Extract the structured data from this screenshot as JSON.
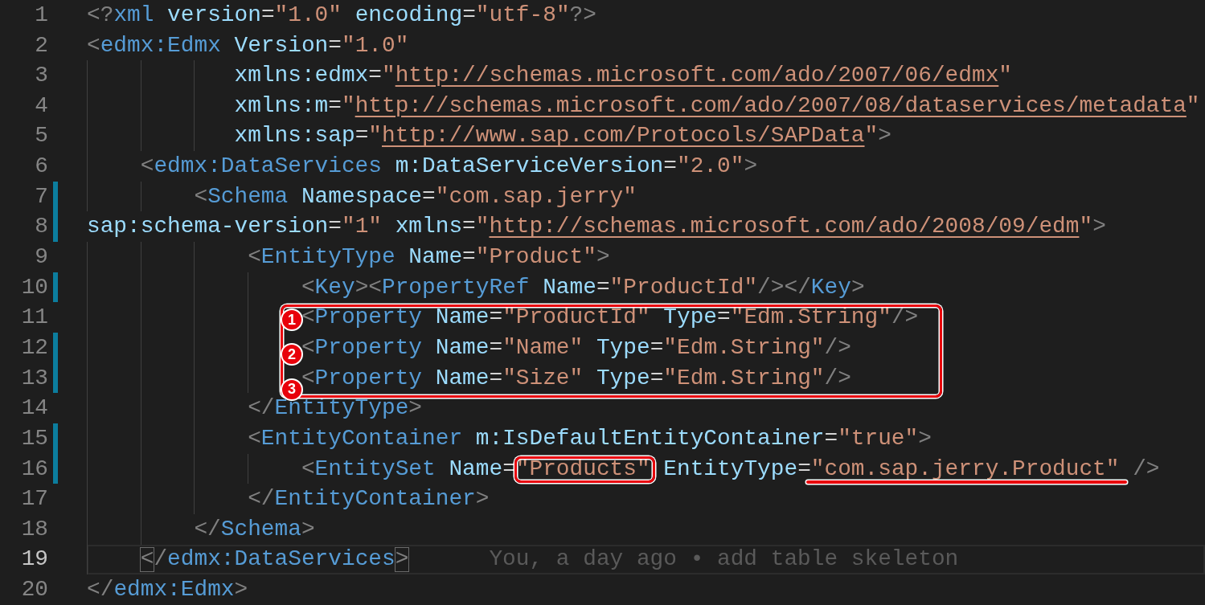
{
  "editor": {
    "lines": [
      {
        "number": "1",
        "changed": false,
        "boxed": false,
        "current": false,
        "tokens": [
          {
            "kind": "punct",
            "text": "<?"
          },
          {
            "kind": "tag",
            "text": "xml "
          },
          {
            "kind": "attr",
            "text": "version"
          },
          {
            "kind": "eq",
            "text": "="
          },
          {
            "kind": "str",
            "text": "\"1.0\" "
          },
          {
            "kind": "attr",
            "text": "encoding"
          },
          {
            "kind": "eq",
            "text": "="
          },
          {
            "kind": "str",
            "text": "\"utf-8\""
          },
          {
            "kind": "punct",
            "text": "?>"
          }
        ]
      },
      {
        "number": "2",
        "changed": false,
        "boxed": false,
        "current": false,
        "tokens": [
          {
            "kind": "punct",
            "text": "<"
          },
          {
            "kind": "tag",
            "text": "edmx:Edmx "
          },
          {
            "kind": "attr",
            "text": "Version"
          },
          {
            "kind": "eq",
            "text": "="
          },
          {
            "kind": "str",
            "text": "\"1.0\""
          }
        ]
      },
      {
        "number": "3",
        "changed": false,
        "boxed": false,
        "current": false,
        "tokens": [
          {
            "kind": "attr",
            "text": "           xmlns:edmx"
          },
          {
            "kind": "eq",
            "text": "="
          },
          {
            "kind": "str",
            "text": "\""
          },
          {
            "kind": "url",
            "text": "http://schemas.microsoft.com/ado/2007/06/edmx"
          },
          {
            "kind": "str",
            "text": "\""
          }
        ]
      },
      {
        "number": "4",
        "changed": false,
        "boxed": false,
        "current": false,
        "tokens": [
          {
            "kind": "attr",
            "text": "           xmlns:m"
          },
          {
            "kind": "eq",
            "text": "="
          },
          {
            "kind": "str",
            "text": "\""
          },
          {
            "kind": "url",
            "text": "http://schemas.microsoft.com/ado/2007/08/dataservices/metadata"
          },
          {
            "kind": "str",
            "text": "\""
          }
        ]
      },
      {
        "number": "5",
        "changed": false,
        "boxed": false,
        "current": false,
        "tokens": [
          {
            "kind": "attr",
            "text": "           xmlns:sap"
          },
          {
            "kind": "eq",
            "text": "="
          },
          {
            "kind": "str",
            "text": "\""
          },
          {
            "kind": "url",
            "text": "http://www.sap.com/Protocols/SAPData"
          },
          {
            "kind": "str",
            "text": "\""
          },
          {
            "kind": "punct",
            "text": ">"
          }
        ]
      },
      {
        "number": "6",
        "changed": false,
        "boxed": false,
        "current": false,
        "tokens": [
          {
            "kind": "punct",
            "text": "    <"
          },
          {
            "kind": "tag",
            "text": "edmx:DataServices "
          },
          {
            "kind": "attr",
            "text": "m:DataServiceVersion"
          },
          {
            "kind": "eq",
            "text": "="
          },
          {
            "kind": "str",
            "text": "\"2.0\""
          },
          {
            "kind": "punct",
            "text": ">"
          }
        ]
      },
      {
        "number": "7",
        "changed": true,
        "boxed": false,
        "current": false,
        "tokens": [
          {
            "kind": "punct",
            "text": "        <"
          },
          {
            "kind": "tag",
            "text": "Schema "
          },
          {
            "kind": "attr",
            "text": "Namespace"
          },
          {
            "kind": "eq",
            "text": "="
          },
          {
            "kind": "str",
            "text": "\"com.sap.jerry\""
          }
        ]
      },
      {
        "number": "8",
        "changed": true,
        "boxed": false,
        "current": false,
        "tokens": [
          {
            "kind": "attr",
            "text": "sap:schema-version"
          },
          {
            "kind": "eq",
            "text": "="
          },
          {
            "kind": "str",
            "text": "\"1\" "
          },
          {
            "kind": "attr",
            "text": "xmlns"
          },
          {
            "kind": "eq",
            "text": "="
          },
          {
            "kind": "str",
            "text": "\""
          },
          {
            "kind": "url",
            "text": "http://schemas.microsoft.com/ado/2008/09/edm"
          },
          {
            "kind": "str",
            "text": "\""
          },
          {
            "kind": "punct",
            "text": ">"
          }
        ]
      },
      {
        "number": "9",
        "changed": false,
        "boxed": false,
        "current": false,
        "tokens": [
          {
            "kind": "punct",
            "text": "            <"
          },
          {
            "kind": "tag",
            "text": "EntityType "
          },
          {
            "kind": "attr",
            "text": "Name"
          },
          {
            "kind": "eq",
            "text": "="
          },
          {
            "kind": "str",
            "text": "\"Product\""
          },
          {
            "kind": "punct",
            "text": ">"
          }
        ]
      },
      {
        "number": "10",
        "changed": true,
        "boxed": false,
        "current": false,
        "tokens": [
          {
            "kind": "punct",
            "text": "                <"
          },
          {
            "kind": "tag",
            "text": "Key"
          },
          {
            "kind": "punct",
            "text": "><"
          },
          {
            "kind": "tag",
            "text": "PropertyRef "
          },
          {
            "kind": "attr",
            "text": "Name"
          },
          {
            "kind": "eq",
            "text": "="
          },
          {
            "kind": "str",
            "text": "\"ProductId\""
          },
          {
            "kind": "punct",
            "text": "/></"
          },
          {
            "kind": "tag",
            "text": "Key"
          },
          {
            "kind": "punct",
            "text": ">"
          }
        ]
      },
      {
        "number": "11",
        "changed": false,
        "boxed": true,
        "current": false,
        "badge": "1",
        "tokens": [
          {
            "kind": "punct",
            "text": "                <"
          },
          {
            "kind": "tag",
            "text": "Property "
          },
          {
            "kind": "attr",
            "text": "Name"
          },
          {
            "kind": "eq",
            "text": "="
          },
          {
            "kind": "str",
            "text": "\"ProductId\" "
          },
          {
            "kind": "attr",
            "text": "Type"
          },
          {
            "kind": "eq",
            "text": "="
          },
          {
            "kind": "str",
            "text": "\"Edm.String\""
          },
          {
            "kind": "punct",
            "text": "/>"
          }
        ]
      },
      {
        "number": "12",
        "changed": true,
        "boxed": true,
        "current": false,
        "badge": "2",
        "tokens": [
          {
            "kind": "punct",
            "text": "                <"
          },
          {
            "kind": "tag",
            "text": "Property "
          },
          {
            "kind": "attr",
            "text": "Name"
          },
          {
            "kind": "eq",
            "text": "="
          },
          {
            "kind": "str",
            "text": "\"Name\" "
          },
          {
            "kind": "attr",
            "text": "Type"
          },
          {
            "kind": "eq",
            "text": "="
          },
          {
            "kind": "str",
            "text": "\"Edm.String\""
          },
          {
            "kind": "punct",
            "text": "/>"
          }
        ]
      },
      {
        "number": "13",
        "changed": true,
        "boxed": true,
        "current": false,
        "badge": "3",
        "tokens": [
          {
            "kind": "punct",
            "text": "                <"
          },
          {
            "kind": "tag",
            "text": "Property "
          },
          {
            "kind": "attr",
            "text": "Name"
          },
          {
            "kind": "eq",
            "text": "="
          },
          {
            "kind": "str",
            "text": "\"Size\" "
          },
          {
            "kind": "attr",
            "text": "Type"
          },
          {
            "kind": "eq",
            "text": "="
          },
          {
            "kind": "str",
            "text": "\"Edm.String\""
          },
          {
            "kind": "punct",
            "text": "/>"
          }
        ]
      },
      {
        "number": "14",
        "changed": false,
        "boxed": false,
        "current": false,
        "tokens": [
          {
            "kind": "punct",
            "text": "            </"
          },
          {
            "kind": "tag",
            "text": "EntityType"
          },
          {
            "kind": "punct",
            "text": ">"
          }
        ]
      },
      {
        "number": "15",
        "changed": true,
        "boxed": false,
        "current": false,
        "tokens": [
          {
            "kind": "punct",
            "text": "            <"
          },
          {
            "kind": "tag",
            "text": "EntityContainer "
          },
          {
            "kind": "attr",
            "text": "m:IsDefaultEntityContainer"
          },
          {
            "kind": "eq",
            "text": "="
          },
          {
            "kind": "str",
            "text": "\"true\""
          },
          {
            "kind": "punct",
            "text": ">"
          }
        ]
      },
      {
        "number": "16",
        "changed": true,
        "boxed": false,
        "current": false,
        "tokens": [
          {
            "kind": "punct",
            "text": "                <"
          },
          {
            "kind": "tag",
            "text": "EntitySet "
          },
          {
            "kind": "attr",
            "text": "Name"
          },
          {
            "kind": "eq",
            "text": "="
          },
          {
            "kind": "str",
            "text": "\"Products\"",
            "circled": true
          },
          {
            "kind": "attr",
            "text": " EntityType"
          },
          {
            "kind": "eq",
            "text": "="
          },
          {
            "kind": "str",
            "text": "\"com.sap.jerry.Product\"",
            "underlined": true
          },
          {
            "kind": "punct",
            "text": " />"
          }
        ]
      },
      {
        "number": "17",
        "changed": false,
        "boxed": false,
        "current": false,
        "tokens": [
          {
            "kind": "punct",
            "text": "            </"
          },
          {
            "kind": "tag",
            "text": "EntityContainer"
          },
          {
            "kind": "punct",
            "text": ">"
          }
        ]
      },
      {
        "number": "18",
        "changed": false,
        "boxed": false,
        "current": false,
        "tokens": [
          {
            "kind": "punct",
            "text": "        </"
          },
          {
            "kind": "tag",
            "text": "Schema"
          },
          {
            "kind": "punct",
            "text": ">"
          }
        ]
      },
      {
        "number": "19",
        "changed": false,
        "boxed": false,
        "current": true,
        "matched_brackets": true,
        "blame": "You, a day ago • add table skeleton",
        "tokens": [
          {
            "kind": "punct",
            "text": "    <"
          },
          {
            "kind": "punct",
            "text": "/"
          },
          {
            "kind": "tag",
            "text": "edmx:DataServices"
          },
          {
            "kind": "punct",
            "text": ">"
          }
        ]
      },
      {
        "number": "20",
        "changed": false,
        "boxed": false,
        "current": false,
        "tokens": [
          {
            "kind": "punct",
            "text": "</"
          },
          {
            "kind": "tag",
            "text": "edmx:Edmx"
          },
          {
            "kind": "punct",
            "text": ">"
          }
        ]
      }
    ]
  }
}
